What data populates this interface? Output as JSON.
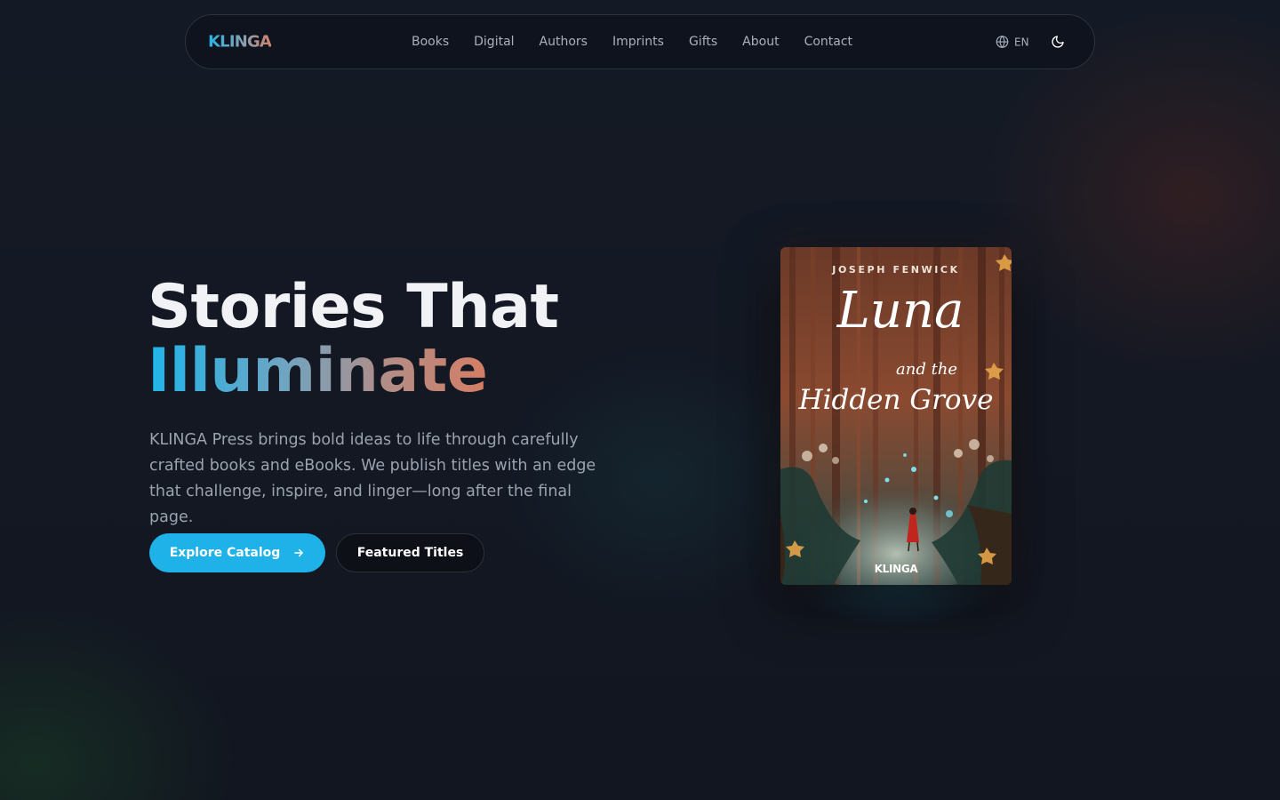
{
  "nav": {
    "brand": "KLINGA",
    "links": [
      "Books",
      "Digital",
      "Authors",
      "Imprints",
      "Gifts",
      "About",
      "Contact"
    ],
    "language": "EN",
    "language_icon": "globe-icon",
    "theme_icon": "moon-icon"
  },
  "hero": {
    "title_line1": "Stories That",
    "title_line2": "Illuminate",
    "description": "KLINGA Press brings bold ideas to life through carefully crafted books and eBooks. We publish titles with an edge that challenge, inspire, and linger—long after the final page.",
    "primary_cta": "Explore Catalog",
    "primary_cta_icon": "arrow-right-icon",
    "secondary_cta": "Featured Titles"
  },
  "featured_book": {
    "author": "JOSEPH FENWICK",
    "title_main": "Luna",
    "title_connector": "and the",
    "title_rest": "Hidden Grove",
    "publisher": "KLINGA"
  },
  "colors": {
    "accent": "#1fb2e8",
    "brand_gradient_start": "#25b3e6",
    "brand_gradient_end": "#d3836c",
    "background": "#121722"
  }
}
